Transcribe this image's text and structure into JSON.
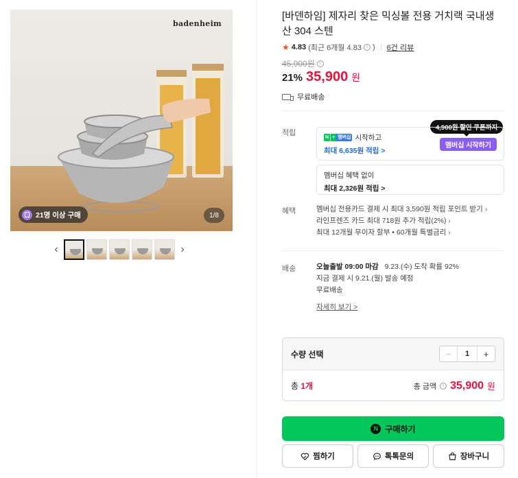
{
  "gallery": {
    "brand": "badenheim",
    "buy_badge": "21명 이상 구매",
    "page_indicator": "1/8",
    "thumb_count": 5
  },
  "product": {
    "title": "[바덴하임] 제자리 찾은 믹싱볼 전용 거치랙 국내생산 304 스텐",
    "rating": "4.83",
    "rating_recent": "(최근 6개월 4.83",
    "reviews": "6건 리뷰",
    "original_price": "45,900원",
    "discount_rate": "21%",
    "price": "35,900",
    "price_unit": "원",
    "shipping": "무료배송"
  },
  "earn": {
    "label": "적립",
    "npay_badge": [
      "N",
      "+",
      "멤버십"
    ],
    "start_text": "시작하고",
    "max_membership": "최대 6,635원 적립 >",
    "join_button": "멤버십 시작하기",
    "tooltip": "4,900원 할인 쿠폰까지",
    "no_member_title": "멤버십 혜택 없이",
    "no_member_max": "최대 2,326원 적립 >"
  },
  "benefits": {
    "label": "혜택",
    "items": [
      "멤버십 전용카드 결제 시 최대 3,590원 적립 포인트 받기",
      "라인프렌즈 카드 최대 718원 추가 적립(2%)",
      "최대 12개월 무이자 할부 • 60개월 특별금리"
    ]
  },
  "delivery": {
    "label": "배송",
    "bold": "오늘출발 09:00 마감",
    "arrival": "9.23.(수) 도착 확률 92%",
    "ship_date": "지금 결제 시 9.21.(월) 발송 예정",
    "fee": "무료배송",
    "more": "자세히 보기 >"
  },
  "quantity": {
    "title": "수량 선택",
    "minus": "−",
    "value": "1",
    "plus": "+",
    "count_prefix": "총 ",
    "count_value": "1개",
    "total_label": "총 금액",
    "total_value": "35,900",
    "total_unit": "원"
  },
  "buttons": {
    "buy": "구매하기",
    "wish": "찜하기",
    "talk": "톡톡문의",
    "cart": "장바구니"
  },
  "colors": {
    "accent_red": "#e8123c",
    "naver_green": "#03c75a",
    "membership_purple": "#8b5cf6",
    "link_blue": "#1e6de4"
  }
}
